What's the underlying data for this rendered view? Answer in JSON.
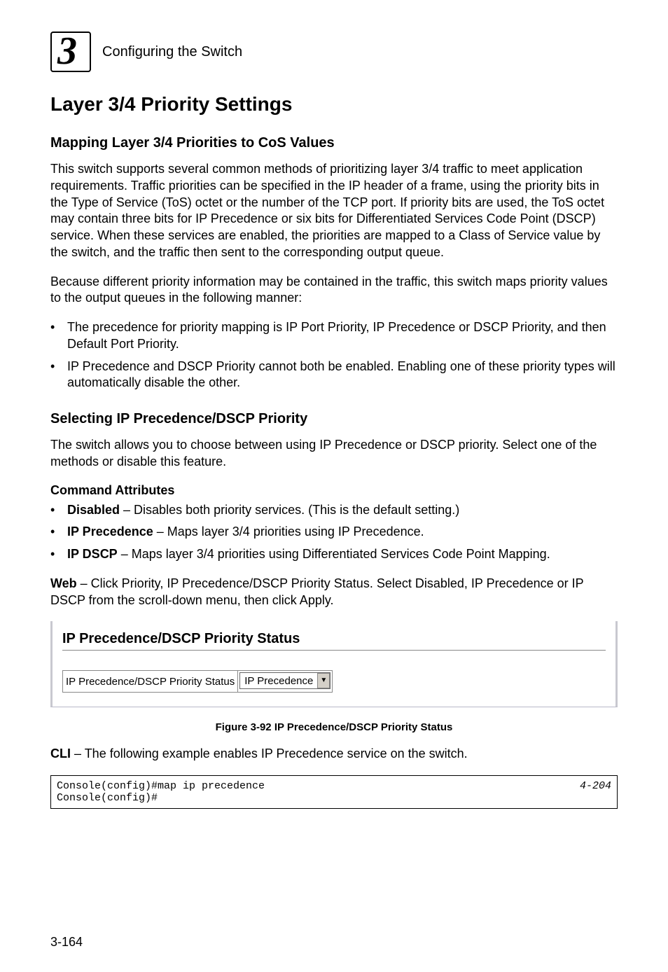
{
  "header": {
    "chapter_number": "3",
    "chapter_title": "Configuring the Switch"
  },
  "title_h1": "Layer 3/4 Priority Settings",
  "section1": {
    "heading": "Mapping Layer 3/4 Priorities to CoS Values",
    "para1": "This switch supports several common methods of prioritizing layer 3/4 traffic to meet application requirements. Traffic priorities can be specified in the IP header of a frame, using the priority bits in the Type of Service (ToS) octet or the number of the TCP port. If priority bits are used, the ToS octet may contain three bits for IP Precedence or six bits for Differentiated Services Code Point (DSCP) service. When these services are enabled, the priorities are mapped to a Class of Service value by the switch, and the traffic then sent to the corresponding output queue.",
    "para2": "Because different priority information may be contained in the traffic, this switch maps priority values to the output queues in the following manner:",
    "bullets": [
      "The precedence for priority mapping is IP Port Priority, IP Precedence or DSCP Priority, and then Default Port Priority.",
      "IP Precedence and DSCP Priority cannot both be enabled. Enabling one of these priority types will automatically disable the other."
    ]
  },
  "section2": {
    "heading": "Selecting IP Precedence/DSCP Priority",
    "para1": "The switch allows you to choose between using IP Precedence or DSCP priority. Select one of the methods or disable this feature.",
    "cmd_attr_heading": "Command Attributes",
    "attrs": [
      {
        "name": "Disabled",
        "desc": " – Disables both priority services. (This is the default setting.)"
      },
      {
        "name": "IP Precedence",
        "desc": " – Maps layer 3/4 priorities using IP Precedence."
      },
      {
        "name": "IP DSCP",
        "desc": " – Maps layer 3/4 priorities using Differentiated Services Code Point Mapping."
      }
    ],
    "web_label": "Web",
    "web_text": " – Click Priority, IP Precedence/DSCP Priority Status. Select Disabled, IP Precedence or IP DSCP from the scroll-down menu, then click Apply.",
    "screenshot": {
      "title": "IP Precedence/DSCP Priority Status",
      "field_label": "IP Precedence/DSCP Priority Status",
      "select_value": "IP Precedence"
    },
    "figure_caption": "Figure 3-92  IP Precedence/DSCP Priority Status",
    "cli_label": "CLI",
    "cli_text": " – The following example enables IP Precedence service on the switch.",
    "cli_lines": [
      {
        "cmd": "Console(config)#map ip precedence",
        "ref": "4-204"
      },
      {
        "cmd": "Console(config)#",
        "ref": ""
      }
    ]
  },
  "page_number": "3-164"
}
